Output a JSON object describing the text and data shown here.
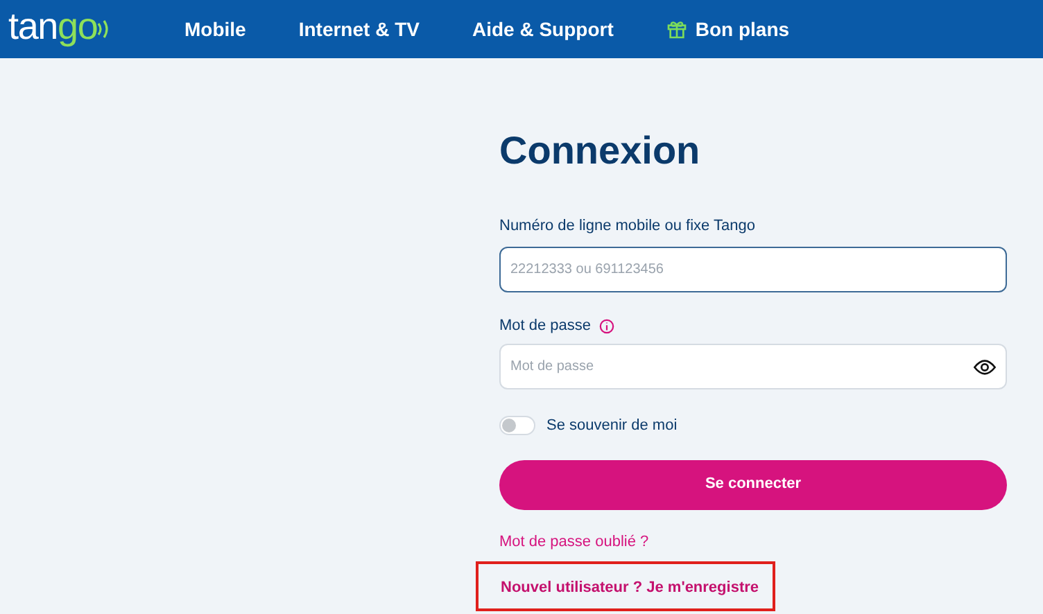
{
  "header": {
    "logo": {
      "parts": [
        "tan",
        "go"
      ]
    },
    "nav": [
      {
        "label": "Mobile",
        "kind": "plain"
      },
      {
        "label": "Internet & TV",
        "kind": "plain"
      },
      {
        "label": "Aide & Support",
        "kind": "plain"
      },
      {
        "label": "Bon plans",
        "kind": "gift"
      }
    ]
  },
  "login": {
    "title": "Connexion",
    "phone": {
      "label": "Numéro de ligne mobile ou fixe Tango",
      "placeholder": "22212333 ou 691123456",
      "focused": true
    },
    "password": {
      "label": "Mot de passe",
      "placeholder": "Mot de passe"
    },
    "remember": {
      "label": "Se souvenir de moi",
      "on": false
    },
    "submit": "Se connecter",
    "forgot": "Mot de passe oublié ?",
    "register": {
      "label": "Nouvel utilisateur ? Je m'enregistre",
      "highlighted": true
    }
  }
}
